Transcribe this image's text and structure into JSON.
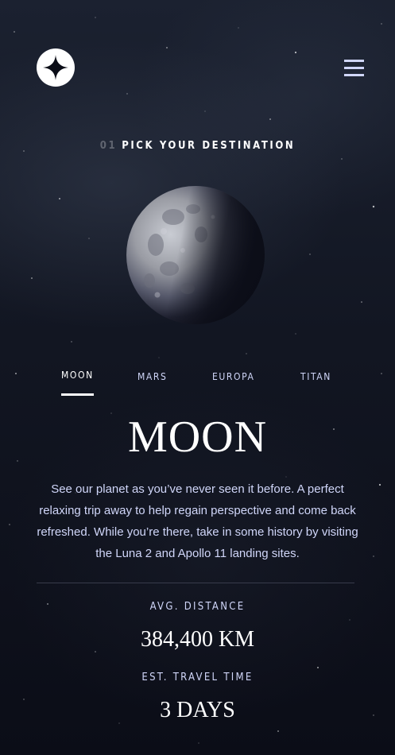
{
  "brand": {
    "logo_icon": "four-point-star-icon"
  },
  "nav": {
    "menu_icon": "hamburger-menu-icon"
  },
  "heading": {
    "number": "01",
    "text": "PICK YOUR DESTINATION"
  },
  "planet_image": "moon-image",
  "tabs": [
    {
      "label": "MOON",
      "active": true
    },
    {
      "label": "MARS",
      "active": false
    },
    {
      "label": "EUROPA",
      "active": false
    },
    {
      "label": "TITAN",
      "active": false
    }
  ],
  "destination": {
    "name": "MOON",
    "description": "See our planet as you’ve never seen it before. A perfect relaxing trip away to help regain perspective and come back refreshed. While you’re there, take in some history by visiting the Luna 2 and Apollo 11 landing sites.",
    "stats": {
      "distance_label": "AVG. DISTANCE",
      "distance_value": "384,400 KM",
      "travel_label": "EST. TRAVEL TIME",
      "travel_value": "3 DAYS"
    }
  },
  "colors": {
    "background": "#0b0d17",
    "text_primary": "#ffffff",
    "text_secondary": "#d0d6f9",
    "divider": "#383b4b"
  }
}
